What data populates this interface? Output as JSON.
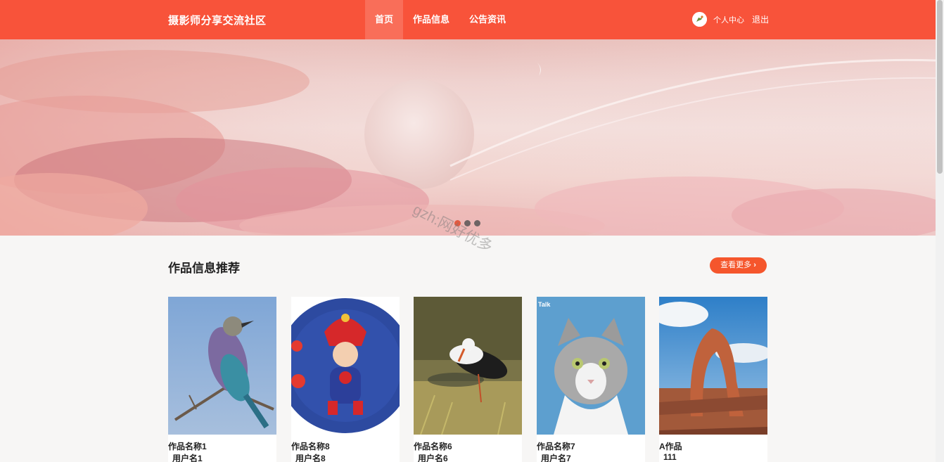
{
  "header": {
    "site_title": "摄影师分享交流社区",
    "nav": [
      "首页",
      "作品信息",
      "公告资讯"
    ],
    "user_center": "个人中心",
    "logout": "退出",
    "brand_color": "#f8533a"
  },
  "banner": {
    "slide_count": 3,
    "active_slide": 1
  },
  "watermark": "gzh:网好优多",
  "section": {
    "title": "作品信息推荐",
    "more_label": "查看更多"
  },
  "works": [
    {
      "name": "作品名称1",
      "user": "用户名1",
      "image": "bird-on-branch"
    },
    {
      "name": "作品名称8",
      "user": "用户名8",
      "image": "baby-in-costume"
    },
    {
      "name": "作品名称6",
      "user": "用户名6",
      "image": "stork-in-grass"
    },
    {
      "name": "作品名称7",
      "user": "用户名7",
      "image": "tabby-cat"
    },
    {
      "name": "A作品",
      "user": "111",
      "image": "desert-arch"
    }
  ],
  "photo_badge": "Talk"
}
